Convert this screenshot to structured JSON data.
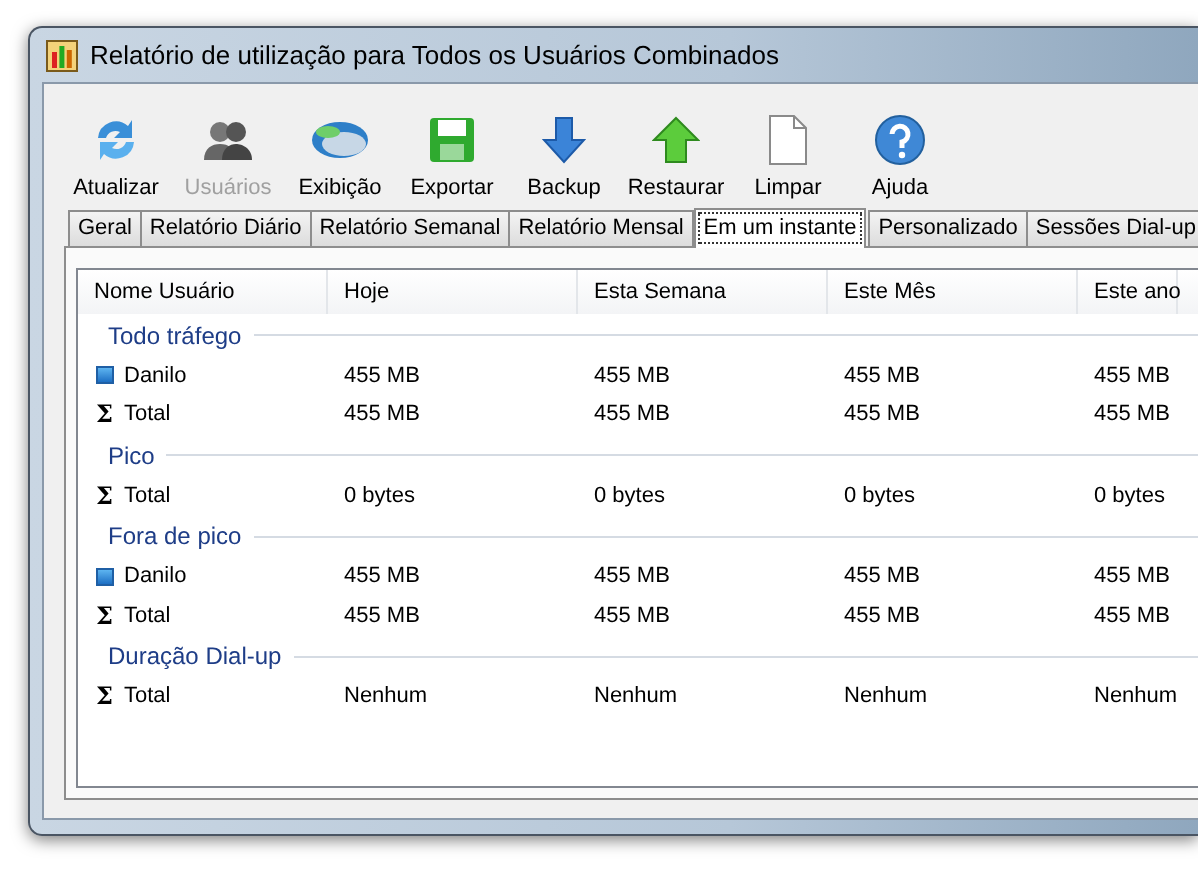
{
  "window": {
    "title": "Relatório de utilização para Todos os Usuários Combinados"
  },
  "toolbar": [
    {
      "label": "Atualizar",
      "disabled": false
    },
    {
      "label": "Usuários",
      "disabled": true
    },
    {
      "label": "Exibição",
      "disabled": false
    },
    {
      "label": "Exportar",
      "disabled": false
    },
    {
      "label": "Backup",
      "disabled": false
    },
    {
      "label": "Restaurar",
      "disabled": false
    },
    {
      "label": "Limpar",
      "disabled": false
    },
    {
      "label": "Ajuda",
      "disabled": false
    }
  ],
  "tabs": [
    {
      "label": "Geral",
      "selected": false
    },
    {
      "label": "Relatório Diário",
      "selected": false
    },
    {
      "label": "Relatório Semanal",
      "selected": false
    },
    {
      "label": "Relatório Mensal",
      "selected": false
    },
    {
      "label": "Em um instante",
      "selected": true
    },
    {
      "label": "Personalizado",
      "selected": false
    },
    {
      "label": "Sessões Dial-up",
      "selected": false
    }
  ],
  "table": {
    "columns": [
      "Nome Usuário",
      "Hoje",
      "Esta Semana",
      "Este Mês",
      "Este ano"
    ],
    "rows": [
      {
        "kind": "group",
        "label": "Todo tráfego"
      },
      {
        "kind": "user",
        "cells": [
          "Danilo",
          "455 MB",
          "455 MB",
          "455 MB",
          "455 MB"
        ]
      },
      {
        "kind": "total",
        "symbol": "Σ",
        "cells": [
          "Total",
          "455 MB",
          "455 MB",
          "455 MB",
          "455 MB"
        ]
      },
      {
        "kind": "group",
        "label": "Pico"
      },
      {
        "kind": "total",
        "symbol": "Σ",
        "cells": [
          "Total",
          "0 bytes",
          "0 bytes",
          "0 bytes",
          "0 bytes"
        ]
      },
      {
        "kind": "group",
        "label": "Fora de pico"
      },
      {
        "kind": "user",
        "cells": [
          "Danilo",
          "455 MB",
          "455 MB",
          "455 MB",
          "455 MB"
        ]
      },
      {
        "kind": "total",
        "symbol": "Σ",
        "cells": [
          "Total",
          "455 MB",
          "455 MB",
          "455 MB",
          "455 MB"
        ]
      },
      {
        "kind": "group",
        "label": "Duração Dial-up"
      },
      {
        "kind": "total",
        "symbol": "Σ",
        "cells": [
          "Total",
          "Nenhum",
          "Nenhum",
          "Nenhum",
          "Nenhum"
        ]
      }
    ]
  }
}
